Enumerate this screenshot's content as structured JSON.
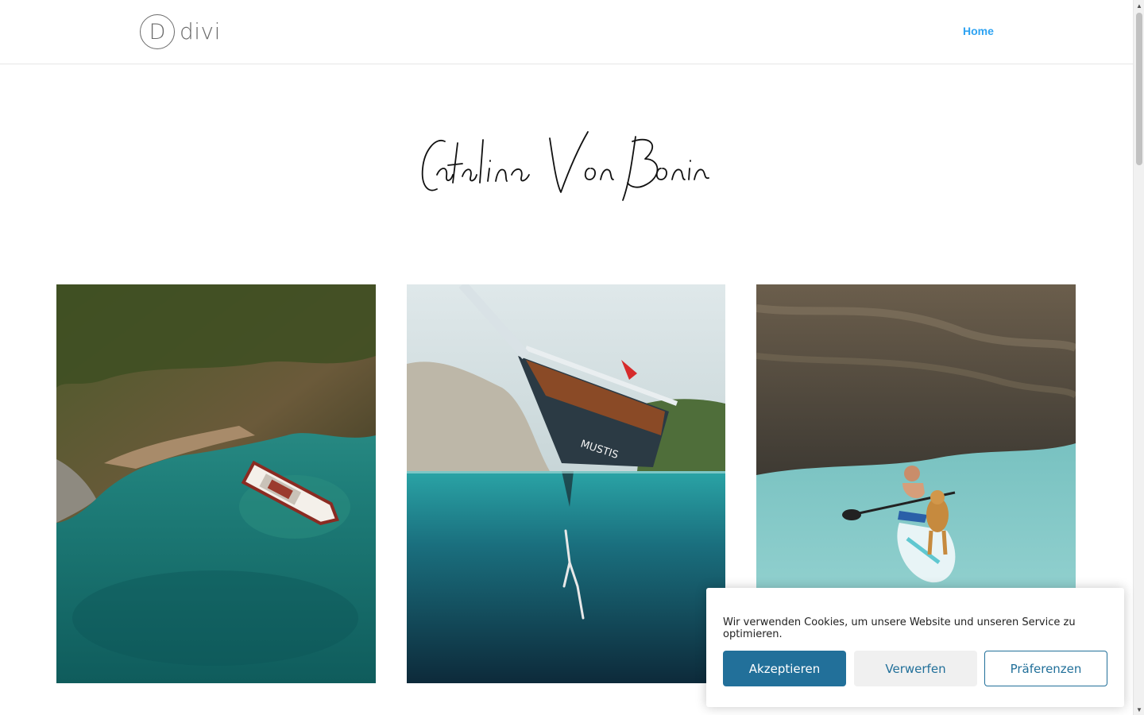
{
  "header": {
    "logo_letter": "D",
    "logo_text": "divi",
    "nav": [
      {
        "label": "Home",
        "active": true
      }
    ]
  },
  "hero": {
    "signature": "Catalina Von Bonin"
  },
  "gallery": {
    "photos": [
      {
        "subject": "aerial view of boat in turquoise bay"
      },
      {
        "subject": "split underwater view of boat hull and diver"
      },
      {
        "subject": "man and dog on paddle board by cliff"
      }
    ]
  },
  "cookie_banner": {
    "message": "Wir verwenden Cookies, um unsere Website und unseren Service zu optimieren.",
    "accept_label": "Akzeptieren",
    "reject_label": "Verwerfen",
    "preferences_label": "Präferenzen"
  },
  "colors": {
    "nav_active": "#2ea3f2",
    "button_primary": "#22709a",
    "button_secondary_bg": "#f0f0f0"
  }
}
